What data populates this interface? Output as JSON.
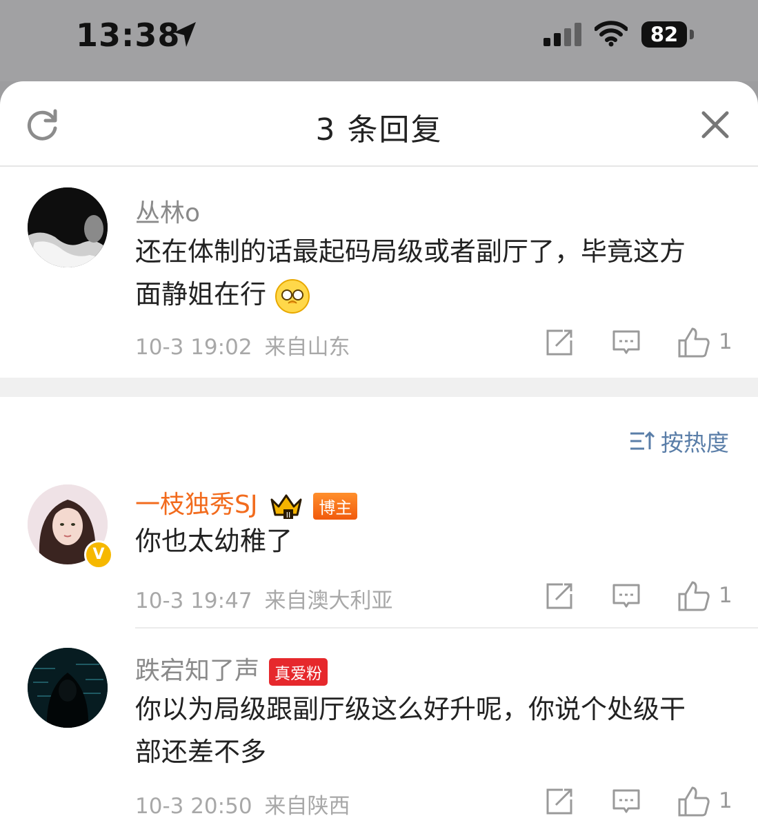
{
  "status_bar": {
    "time": "13:38",
    "battery": "82"
  },
  "header": {
    "title": "3 条回复"
  },
  "root_comment": {
    "username": "丛林o",
    "text": "还在体制的话最起码局级或者副厅了，毕竟这方面静姐在行",
    "emoji": "pointing-hands-emoji",
    "time": "10-3 19:02",
    "location": "来自山东",
    "likes": "1"
  },
  "sort": {
    "label": "按热度"
  },
  "replies": [
    {
      "username": "一枝独秀SJ",
      "badge": "博主",
      "verified": "V",
      "text": "你也太幼稚了",
      "time": "10-3 19:47",
      "location": "来自澳大利亚",
      "likes": "1"
    },
    {
      "username": "跌宕知了声",
      "badge": "真爱粉",
      "text": "你以为局级跟副厅级这么好升呢，你说个处级干部还差不多",
      "time": "10-3 20:50",
      "location": "来自陕西",
      "likes": "1"
    }
  ],
  "colors": {
    "accent": "#f26b1d",
    "link": "#5a7ea8",
    "fan_badge": "#e6282c"
  }
}
